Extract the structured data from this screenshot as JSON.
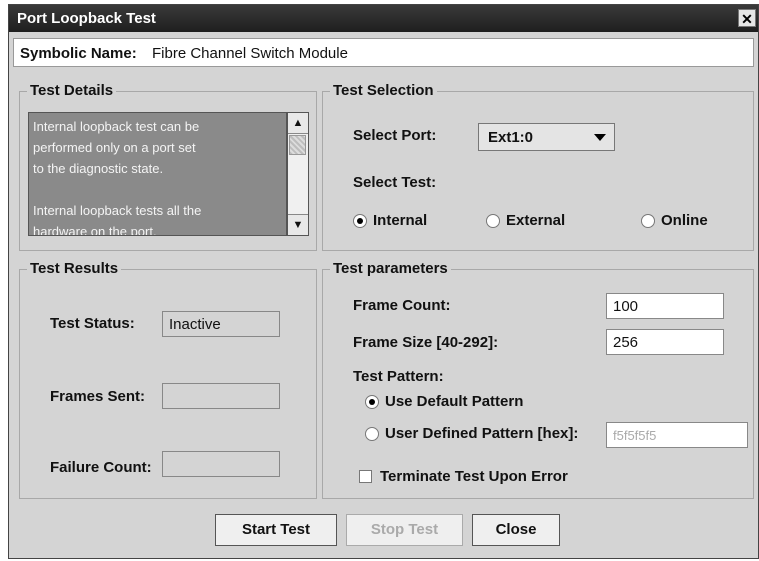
{
  "window": {
    "title": "Port Loopback Test",
    "close_glyph": "✕"
  },
  "symbolic": {
    "label": "Symbolic Name:",
    "value": "Fibre Channel Switch Module"
  },
  "test_details": {
    "legend": "Test Details",
    "lines": [
      "Internal loopback test can be",
      "performed only on a port set",
      "to the diagnostic state.",
      "",
      "Internal loopback tests all the",
      "hardware on the port,"
    ]
  },
  "test_selection": {
    "legend": "Test Selection",
    "select_port_label": "Select Port:",
    "port_value": "Ext1:0",
    "select_test_label": "Select Test:",
    "options": [
      {
        "label": "Internal",
        "selected": true
      },
      {
        "label": "External",
        "selected": false
      },
      {
        "label": "Online",
        "selected": false
      }
    ]
  },
  "test_results": {
    "legend": "Test Results",
    "status_label": "Test Status:",
    "status_value": "Inactive",
    "frames_sent_label": "Frames Sent:",
    "frames_sent_value": "",
    "failure_count_label": "Failure Count:",
    "failure_count_value": ""
  },
  "test_parameters": {
    "legend": "Test parameters",
    "frame_count_label": "Frame Count:",
    "frame_count_value": "100",
    "frame_size_label": "Frame Size [40-292]:",
    "frame_size_value": "256",
    "test_pattern_label": "Test Pattern:",
    "default_pattern_label": "Use Default Pattern",
    "user_pattern_label": "User Defined Pattern [hex]:",
    "user_pattern_value": "f5f5f5f5",
    "terminate_label": "Terminate Test Upon Error"
  },
  "buttons": {
    "start": "Start Test",
    "stop": "Stop Test",
    "close": "Close"
  }
}
